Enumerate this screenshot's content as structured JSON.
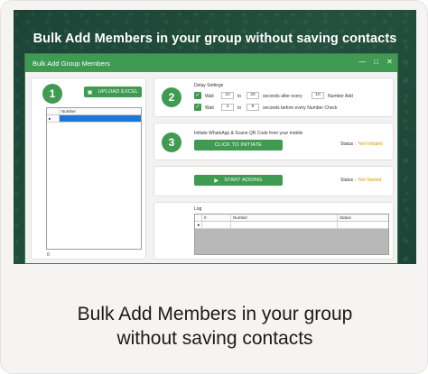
{
  "hero": {
    "title": "Bulk Add Members in your group without saving contacts"
  },
  "window": {
    "title": "Bulk Add Group Members",
    "controls": [
      "—",
      "□",
      "✕"
    ]
  },
  "step1": {
    "number": "1",
    "button_label": "UPLOAD EXCEL",
    "table_header": "Number",
    "row_marker": "▸",
    "count": "0"
  },
  "step2": {
    "number": "2",
    "heading": "Delay Settings",
    "row1": {
      "prefix": "Wait",
      "from": "10",
      "to_word": "to",
      "to": "20",
      "middle": "seconds after every",
      "every": "10",
      "suffix": "Number Add"
    },
    "row2": {
      "prefix": "Wait",
      "from": "4",
      "to_word": "to",
      "to": "8",
      "suffix": "seconds before every Number Check"
    }
  },
  "step3": {
    "number": "3",
    "instruction": "Initiate WhatsApp & Scane QR Code from your mobile",
    "button_label": "CLICK TO INITIATE",
    "status_label": "Status :",
    "status_value": "Not Initiated"
  },
  "step4": {
    "button_label": "START ADDING",
    "status_label": "Status :",
    "status_value": "Not Started"
  },
  "log": {
    "heading": "Log",
    "columns": [
      "#",
      "Number",
      "Status"
    ],
    "row_marker": "★"
  },
  "caption": {
    "line1": "Bulk Add Members in your group",
    "line2": "without saving contacts"
  },
  "colors": {
    "accent": "#3f9a52",
    "status": "#d69a00",
    "hero_bg": "#1f4a3b"
  }
}
